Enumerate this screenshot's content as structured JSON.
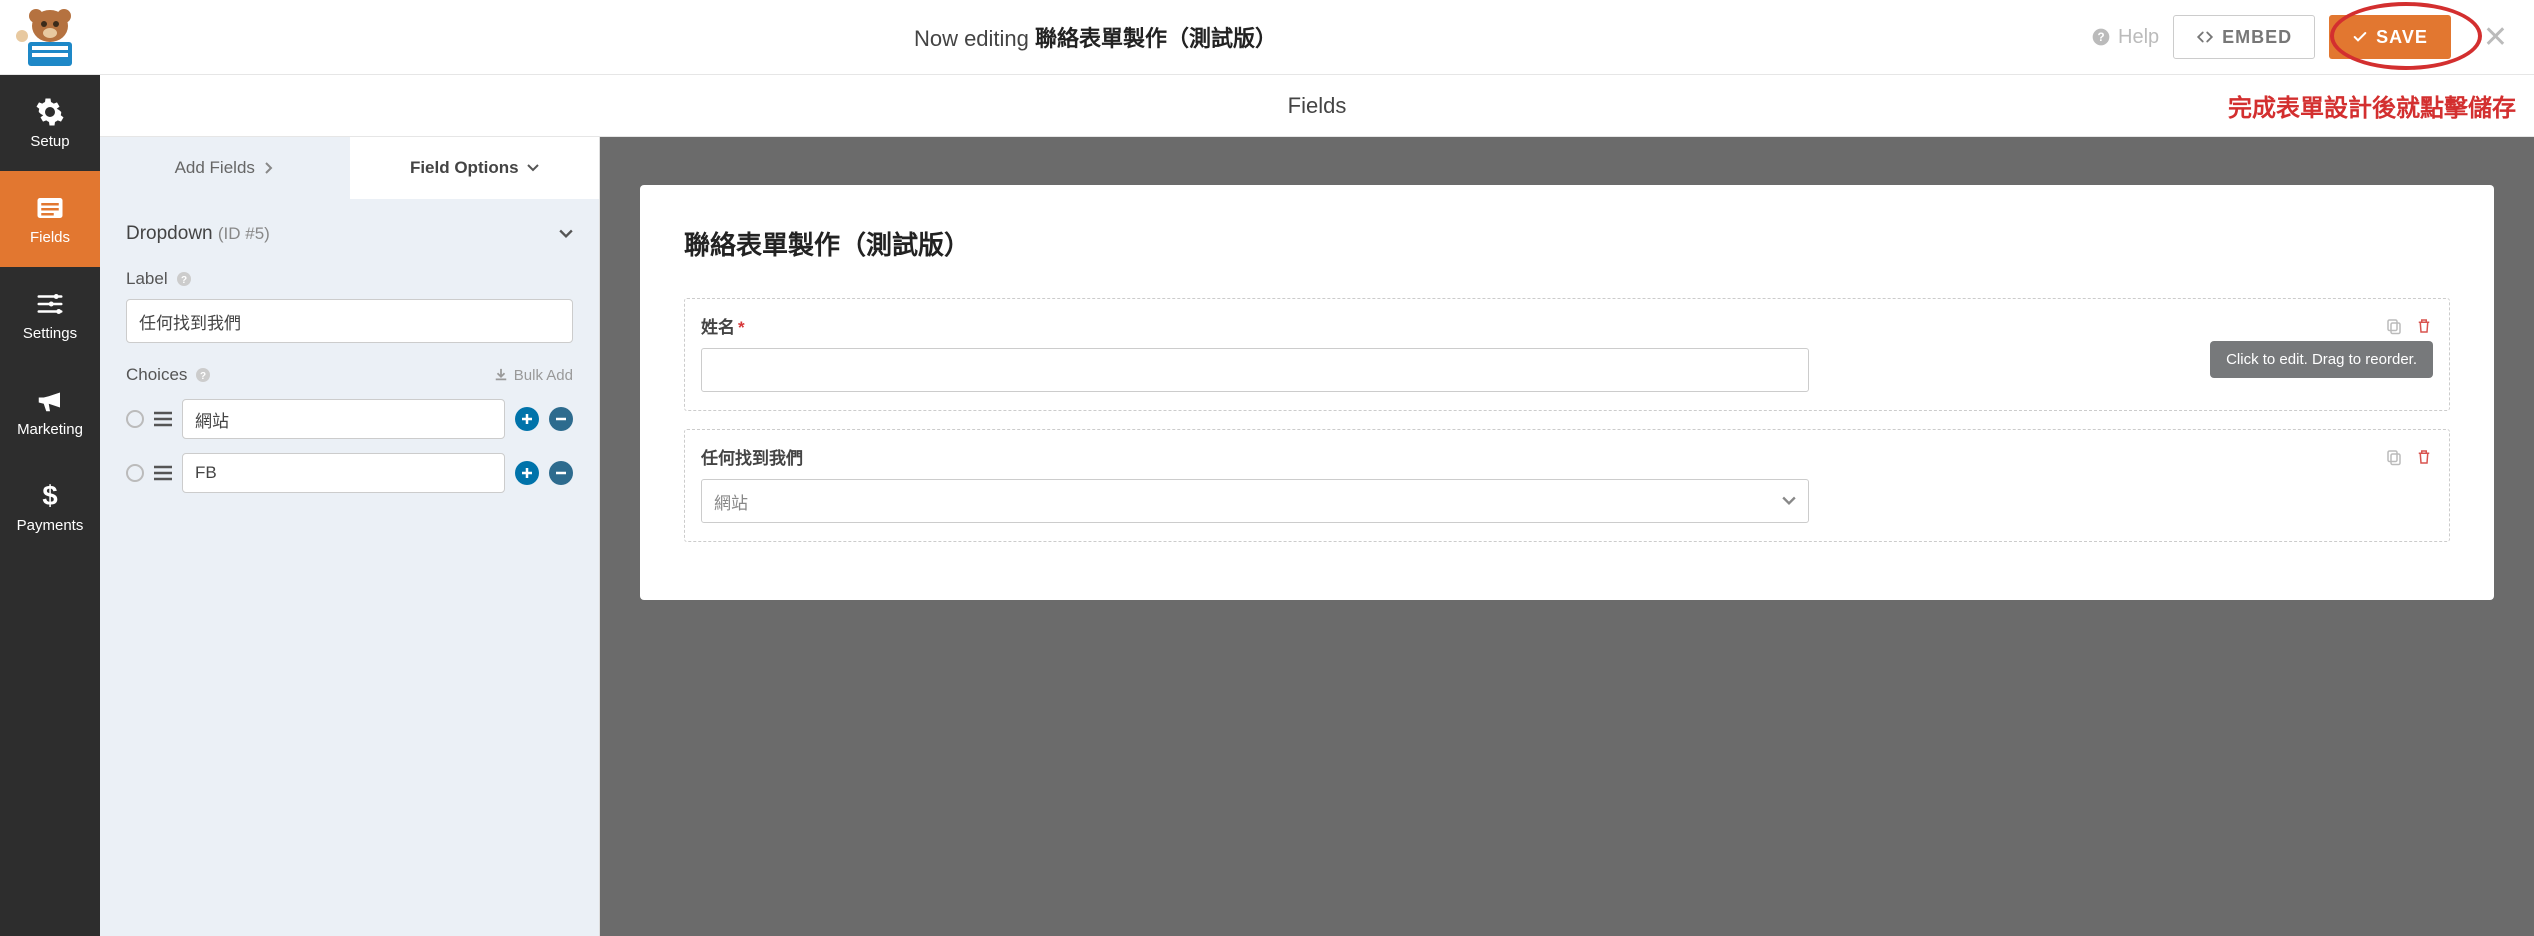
{
  "header": {
    "editing_prefix": "Now editing",
    "form_name": "聯絡表單製作（測試版）",
    "help": "Help",
    "embed": "EMBED",
    "save": "SAVE"
  },
  "fields_title": "Fields",
  "annotation": "完成表單設計後就點擊儲存",
  "nav": {
    "setup": "Setup",
    "fields": "Fields",
    "settings": "Settings",
    "marketing": "Marketing",
    "payments": "Payments"
  },
  "panel": {
    "tab_add": "Add Fields",
    "tab_options": "Field Options",
    "field_type": "Dropdown",
    "field_id": "(ID #5)",
    "label_label": "Label",
    "label_value": "任何找到我們",
    "choices_label": "Choices",
    "bulk_add": "Bulk Add",
    "choices": [
      {
        "value": "網站"
      },
      {
        "value": "FB"
      }
    ]
  },
  "preview": {
    "title": "聯絡表單製作（測試版）",
    "fields": [
      {
        "label": "姓名",
        "required": true,
        "type": "text"
      },
      {
        "label": "任何找到我們",
        "required": false,
        "type": "select",
        "selected": "網站"
      }
    ],
    "tooltip": "Click to edit. Drag to reorder."
  }
}
